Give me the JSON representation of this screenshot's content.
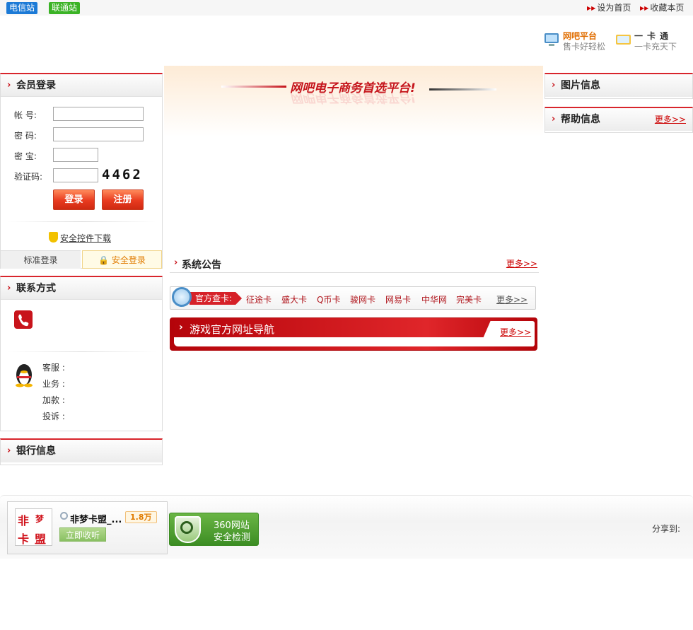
{
  "topbar": {
    "telecom_label": "电信站",
    "unicom_label": "联通站",
    "set_home": "设为首页",
    "bookmark": "收藏本页"
  },
  "header": {
    "feature1_title": "网吧平台",
    "feature1_sub": "售卡好轻松",
    "feature2_title": "一卡通",
    "feature2_sub": "一卡充天下"
  },
  "login": {
    "title": "会员登录",
    "account_label": "帐  号:",
    "password_label": "密  码:",
    "safe_label": "密  宝:",
    "captcha_label": "验证码:",
    "captcha_value": "4462",
    "login_button": "登录",
    "register_button": "注册",
    "download_link": "安全控件下载",
    "tab_standard": "标准登录",
    "tab_secure": "安全登录"
  },
  "contact": {
    "title": "联系方式",
    "lines": [
      "客服 :",
      "业务 :",
      "加款 :",
      "投诉 :"
    ]
  },
  "bank": {
    "title": "银行信息"
  },
  "center": {
    "slogan": "网吧电子商务首选平台!",
    "notice_title": "系统公告",
    "notice_more": "更多>>",
    "card_label": "官方查卡:",
    "cards": [
      "征途卡",
      "盛大卡",
      "Q币卡",
      "骏网卡",
      "网易卡",
      "中华网",
      "完美卡"
    ],
    "cards_more": "更多>>",
    "game_nav_title": "游戏官方网址导航",
    "game_nav_more": "更多>>"
  },
  "right": {
    "pics_title": "图片信息",
    "help_title": "帮助信息",
    "help_more": "更多>>"
  },
  "footer": {
    "logo_chars": [
      "非",
      "梦",
      "卡",
      "盟"
    ],
    "site_name": "非梦卡盟_...",
    "count_badge": "1.8万",
    "collect_button": "立即收听",
    "safe_line1": "360网站",
    "safe_line2": "安全检测",
    "share_label": "分享到:"
  },
  "colors": {
    "accent_red": "#d8252c",
    "brand_orange": "#e06d00"
  }
}
